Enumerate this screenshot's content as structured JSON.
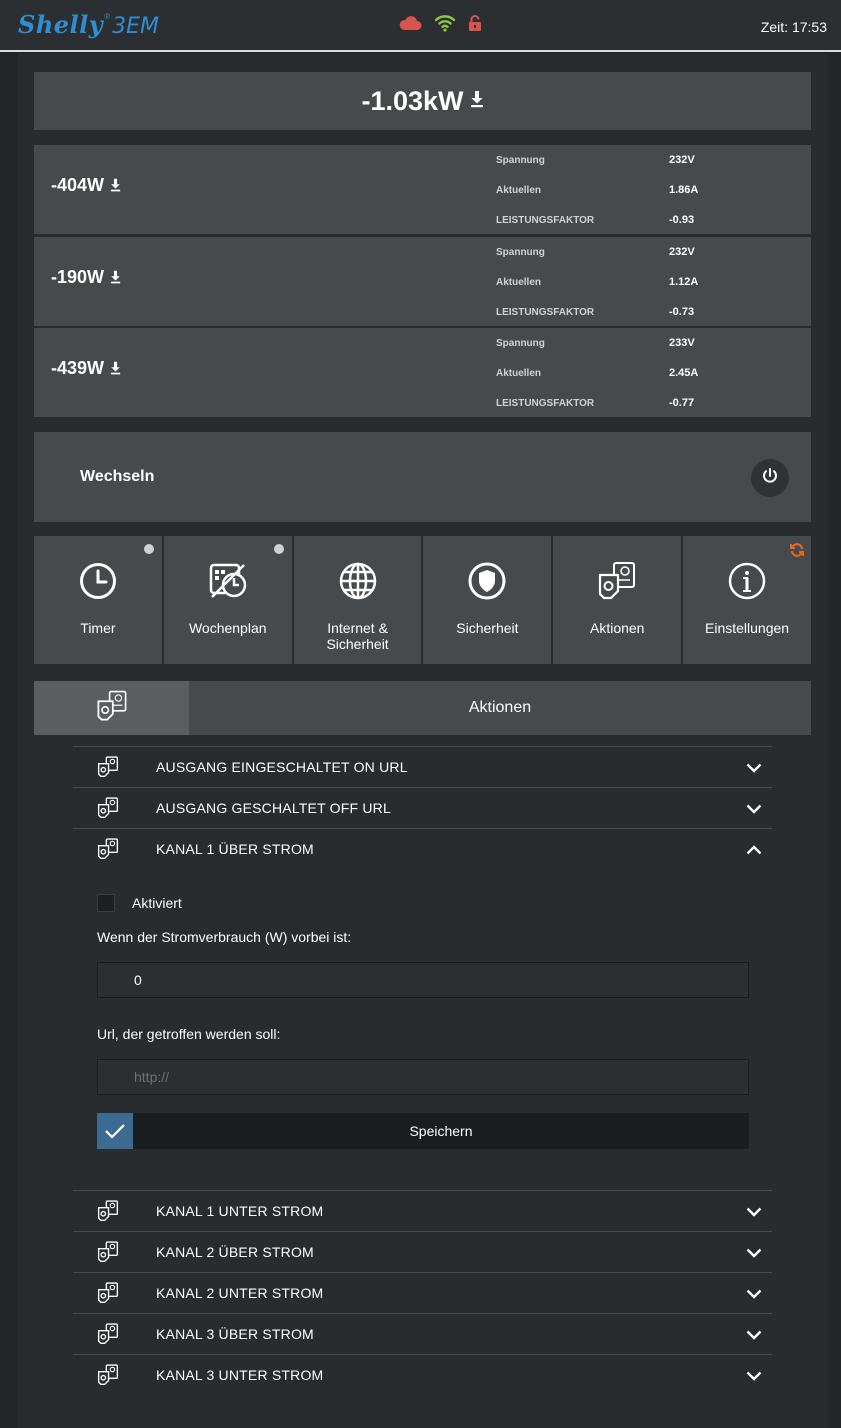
{
  "header": {
    "brand": "Shelly",
    "registered": "®",
    "model": "3EM",
    "clock": "Zeit: 17:53",
    "colors": {
      "cloud": "#d9534f",
      "wifi": "#8cc63f",
      "lock": "#d9534f"
    }
  },
  "total": {
    "value": "-1.03kW"
  },
  "phases": [
    {
      "power": "-404W",
      "voltage_label": "Spannung",
      "voltage": "232V",
      "current_label": "Aktuellen",
      "current": "1.86A",
      "pf_label": "LEISTUNGSFAKTOR",
      "pf": "-0.93"
    },
    {
      "power": "-190W",
      "voltage_label": "Spannung",
      "voltage": "232V",
      "current_label": "Aktuellen",
      "current": "1.12A",
      "pf_label": "LEISTUNGSFAKTOR",
      "pf": "-0.73"
    },
    {
      "power": "-439W",
      "voltage_label": "Spannung",
      "voltage": "233V",
      "current_label": "Aktuellen",
      "current": "2.45A",
      "pf_label": "LEISTUNGSFAKTOR",
      "pf": "-0.77"
    }
  ],
  "switch": {
    "label": "Wechseln"
  },
  "tiles": [
    {
      "label": "Timer",
      "icon": "clock-icon"
    },
    {
      "label": "Wochenplan",
      "icon": "schedule-icon"
    },
    {
      "label_line1": "Internet &",
      "label_line2": "Sicherheit",
      "icon": "globe-icon"
    },
    {
      "label": "Sicherheit",
      "icon": "shield-icon"
    },
    {
      "label": "Aktionen",
      "icon": "actions-icon"
    },
    {
      "label": "Einstellungen",
      "icon": "info-icon"
    }
  ],
  "tab": {
    "title": "Aktionen"
  },
  "actions_top": [
    {
      "label": "AUSGANG EINGESCHALTET ON URL",
      "expanded": false
    },
    {
      "label": "AUSGANG GESCHALTET OFF URL",
      "expanded": false
    },
    {
      "label": "KANAL 1 ÜBER STROM",
      "expanded": true
    }
  ],
  "panel": {
    "enabled_label": "Aktiviert",
    "threshold_label": "Wenn der Stromverbrauch (W) vorbei ist:",
    "threshold_value": "0",
    "url_label": "Url, der getroffen werden soll:",
    "url_placeholder": "http://",
    "save_label": "Speichern"
  },
  "actions_bottom": [
    {
      "label": "KANAL 1 UNTER STROM"
    },
    {
      "label": "KANAL 2 ÜBER STROM"
    },
    {
      "label": "KANAL 2 UNTER STROM"
    },
    {
      "label": "KANAL 3 ÜBER STROM"
    },
    {
      "label": "KANAL 3 UNTER STROM"
    }
  ]
}
